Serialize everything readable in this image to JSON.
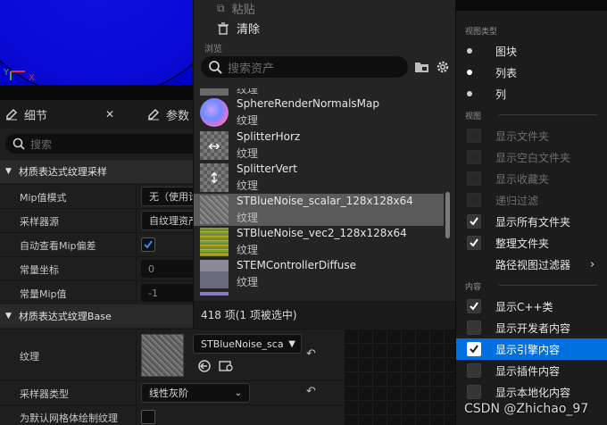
{
  "viewport": {
    "axis_y": "Y",
    "axis_x": "X"
  },
  "details": {
    "tab_details": "细节",
    "tab_params": "参数",
    "search_placeholder": "搜索",
    "cat_sample": "材质表达式纹理采样",
    "mip_mode_label": "Mip值模式",
    "mip_mode_value": "无（使用计",
    "sampler_source_label": "采样器源",
    "sampler_source_value": "自纹理资产",
    "auto_mip_label": "自动查看Mip偏差",
    "const_coord_label": "常量坐标",
    "const_coord_value": "0",
    "const_mip_label": "常量Mip值",
    "const_mip_value": "-1",
    "cat_base": "材质表达式纹理Base",
    "texture_label": "纹理",
    "texture_value": "STBlueNoise_sca",
    "sampler_type_label": "采样器类型",
    "sampler_type_value": "线性灰阶",
    "default_mesh_label": "为默认网格体绘制纹理"
  },
  "browser": {
    "paste": "粘贴",
    "clear": "清除",
    "browse_header": "浏览",
    "search_placeholder": "搜索资产",
    "partial_top": "纹理",
    "assets": [
      {
        "name": "SphereRenderNormalsMap",
        "type": "纹理"
      },
      {
        "name": "SplitterHorz",
        "type": "纹理"
      },
      {
        "name": "SplitterVert",
        "type": "纹理"
      },
      {
        "name": "STBlueNoise_scalar_128x128x64",
        "type": "纹理"
      },
      {
        "name": "STBlueNoise_vec2_128x128x64",
        "type": "纹理"
      },
      {
        "name": "STEMControllerDiffuse",
        "type": "纹理"
      }
    ],
    "status": "418 项(1 项被选中)"
  },
  "view_menu": {
    "view_type_header": "视图类型",
    "tiles": "图块",
    "list": "列表",
    "column": "列",
    "view_header": "视图",
    "show_folders": "显示文件夹",
    "show_empty_folders": "显示空白文件夹",
    "show_favorites": "显示收藏夹",
    "recursive_filter": "递归过滤",
    "show_all_folders": "显示所有文件夹",
    "organize_folders": "整理文件夹",
    "path_view_filter": "路径视图过滤器",
    "content_header": "内容",
    "show_cpp": "显示C++类",
    "show_dev": "显示开发者内容",
    "show_engine": "显示引擎内容",
    "show_plugin": "显示插件内容",
    "show_localized": "显示本地化内容"
  },
  "watermark": "CSDN @Zhichao_97",
  "colors": {
    "highlight": "#0070e0",
    "panel": "#1e1e1e",
    "viewport_blue": "#0000c8"
  }
}
